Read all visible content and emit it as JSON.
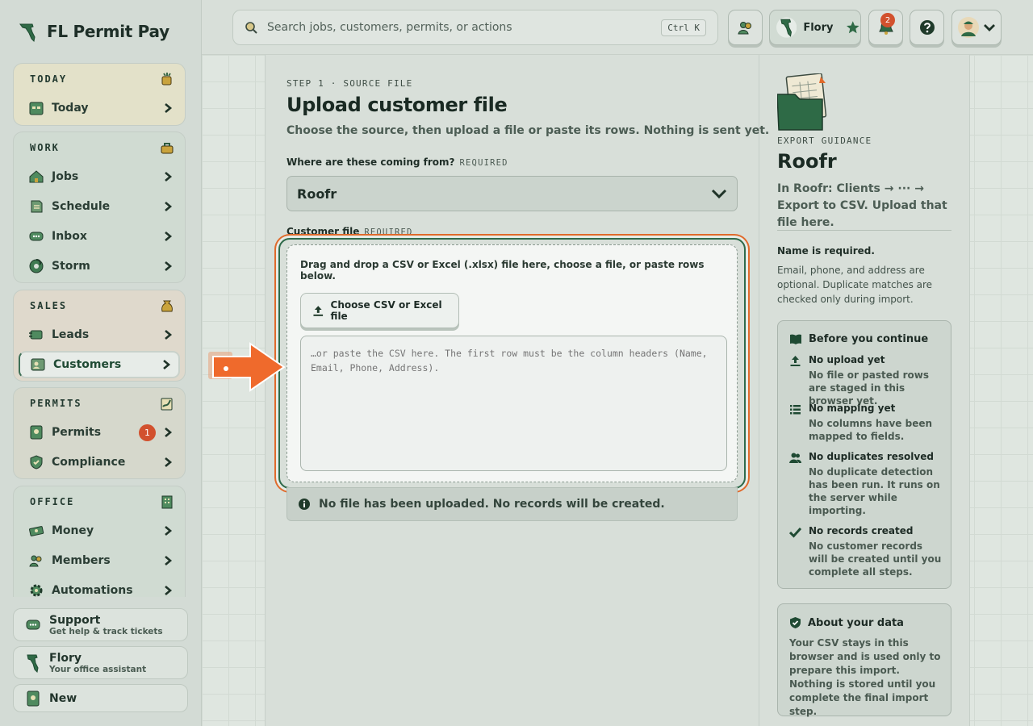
{
  "app": {
    "brand": "FL Permit Pay"
  },
  "search": {
    "placeholder": "Search jobs, customers, permits, or actions",
    "shortcut": "Ctrl K"
  },
  "topbar": {
    "assistant_name": "Flory",
    "notifications_count": "2"
  },
  "sidebar": {
    "groups": [
      {
        "title": "TODAY",
        "items": [
          {
            "label": "Today"
          }
        ]
      },
      {
        "title": "WORK",
        "items": [
          {
            "label": "Jobs"
          },
          {
            "label": "Schedule"
          },
          {
            "label": "Inbox"
          },
          {
            "label": "Storm"
          }
        ]
      },
      {
        "title": "SALES",
        "items": [
          {
            "label": "Leads"
          },
          {
            "label": "Customers",
            "active": true
          }
        ]
      },
      {
        "title": "PERMITS",
        "items": [
          {
            "label": "Permits",
            "badge": "1"
          },
          {
            "label": "Compliance"
          }
        ]
      },
      {
        "title": "OFFICE",
        "items": [
          {
            "label": "Money"
          },
          {
            "label": "Members"
          },
          {
            "label": "Automations"
          }
        ]
      }
    ],
    "support": {
      "title": "Support",
      "subtitle": "Get help & track tickets"
    },
    "assistant": {
      "title": "Flory",
      "subtitle": "Your office assistant"
    },
    "new_label": "New"
  },
  "main": {
    "eyebrow": "STEP 1 · SOURCE FILE",
    "title": "Upload customer file",
    "lead": "Choose the source, then upload a file or paste its rows. Nothing is sent yet.",
    "source_label": "Where are these coming from?",
    "source_required": "REQUIRED",
    "source_value": "Roofr",
    "file_label": "Customer file",
    "file_required": "REQUIRED",
    "drop_text": "Drag and drop a CSV or Excel (.xlsx) file here, choose a file, or paste rows below.",
    "choose_button": "Choose CSV or Excel file",
    "paste_placeholder": "…or paste the CSV here. The first row must be the column headers (Name, Email, Phone, Address).",
    "status": "No file has been uploaded. No records will be created."
  },
  "guidance": {
    "eyebrow": "EXPORT GUIDANCE",
    "title": "Roofr",
    "text": "In Roofr: Clients → ··· → Export to CSV. Upload that file here.",
    "name_required": "Name is required.",
    "optional_text": "Email, phone, and address are optional. Duplicate matches are checked only during import.",
    "before": {
      "title": "Before you continue",
      "items": [
        {
          "title": "No upload yet",
          "desc": "No file or pasted rows are staged in this browser yet.",
          "icon": "upload-icon"
        },
        {
          "title": "No mapping yet",
          "desc": "No columns have been mapped to fields.",
          "icon": "list-icon"
        },
        {
          "title": "No duplicates resolved",
          "desc": "No duplicate detection has been run. It runs on the server while importing.",
          "icon": "people-icon"
        },
        {
          "title": "No records created",
          "desc": "No customer records will be created until you complete all steps.",
          "icon": "check-icon"
        }
      ]
    },
    "about": {
      "title": "About your data",
      "text": "Your CSV stays in this browser and is used only to prepare this import. Nothing is stored until you complete the final import step."
    }
  },
  "colors": {
    "accent": "#2e6a4b",
    "highlight": "#e06a2b",
    "badge": "#d2512e"
  }
}
